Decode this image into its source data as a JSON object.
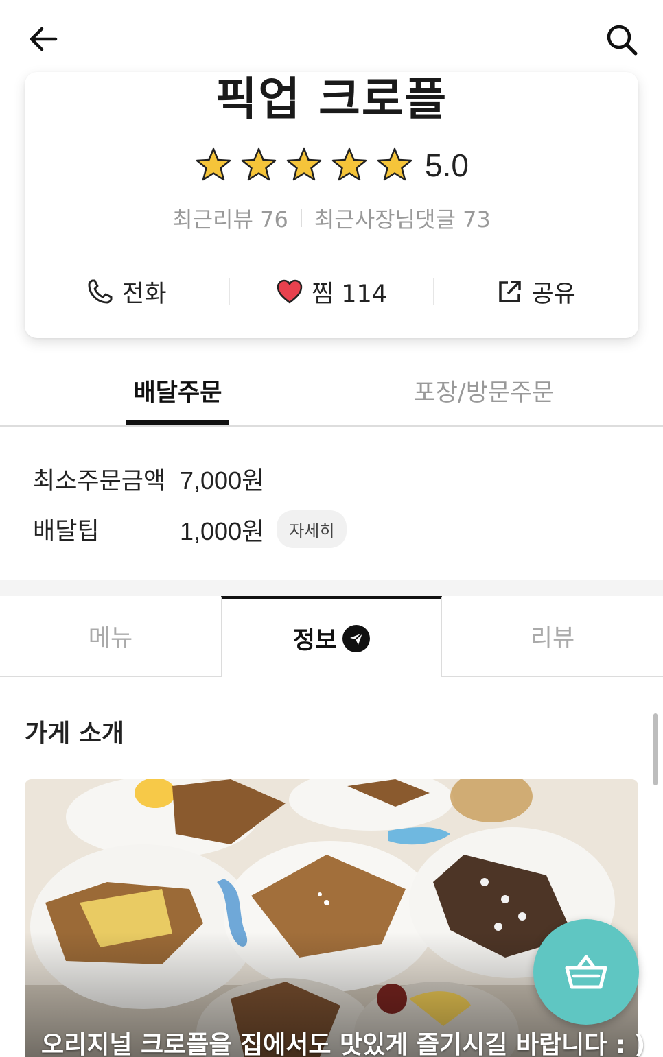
{
  "store": {
    "name": "픽업 크로플",
    "rating": "5.0",
    "rating_stars": 5,
    "recent_reviews_label": "최근리뷰 76",
    "recent_owner_comments_label": "최근사장님댓글 73"
  },
  "actions": {
    "call_label": "전화",
    "favorite_label": "찜 114",
    "share_label": "공유"
  },
  "order_tabs": {
    "delivery": "배달주문",
    "pickup": "포장/방문주문"
  },
  "delivery_info": {
    "min_order_label": "최소주문금액",
    "min_order_value": "7,000원",
    "tip_label": "배달팁",
    "tip_value": "1,000원",
    "detail_button": "자세히"
  },
  "info_tabs": {
    "menu": "메뉴",
    "info": "정보",
    "review": "리뷰"
  },
  "intro": {
    "title": "가게 소개",
    "caption": "오리지널 크로플을 집에서도 맛있게 즐기시길 바랍니다 : )"
  },
  "colors": {
    "accent_teal": "#5fc6c2",
    "star_gold": "#f5c43a",
    "heart_red": "#e8414e"
  },
  "icons": [
    "back-arrow-icon",
    "search-icon",
    "star-icon",
    "phone-icon",
    "heart-icon",
    "share-icon",
    "send-icon",
    "basket-icon"
  ]
}
